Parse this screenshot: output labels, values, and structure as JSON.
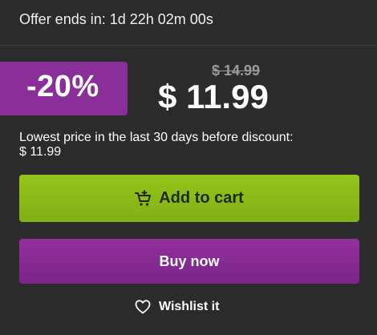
{
  "offer": {
    "text": "Offer ends in: 1d 22h 02m 00s"
  },
  "price": {
    "discount": "-20%",
    "old_price": "$ 14.99",
    "new_price": "$ 11.99"
  },
  "lowest_price": {
    "line1": "Lowest price in the last 30 days before discount:",
    "line2": "$ 11.99"
  },
  "actions": {
    "add_to_cart": "Add to cart",
    "buy_now": "Buy now",
    "wishlist": "Wishlist it"
  },
  "colors": {
    "background": "#2b2b2b",
    "discount_badge": "#8a2f9a",
    "add_to_cart": "#8fbd19",
    "buy_now": "#8a2b98"
  },
  "icons": {
    "cart": "cart-plus-icon",
    "wishlist": "heart-icon"
  }
}
